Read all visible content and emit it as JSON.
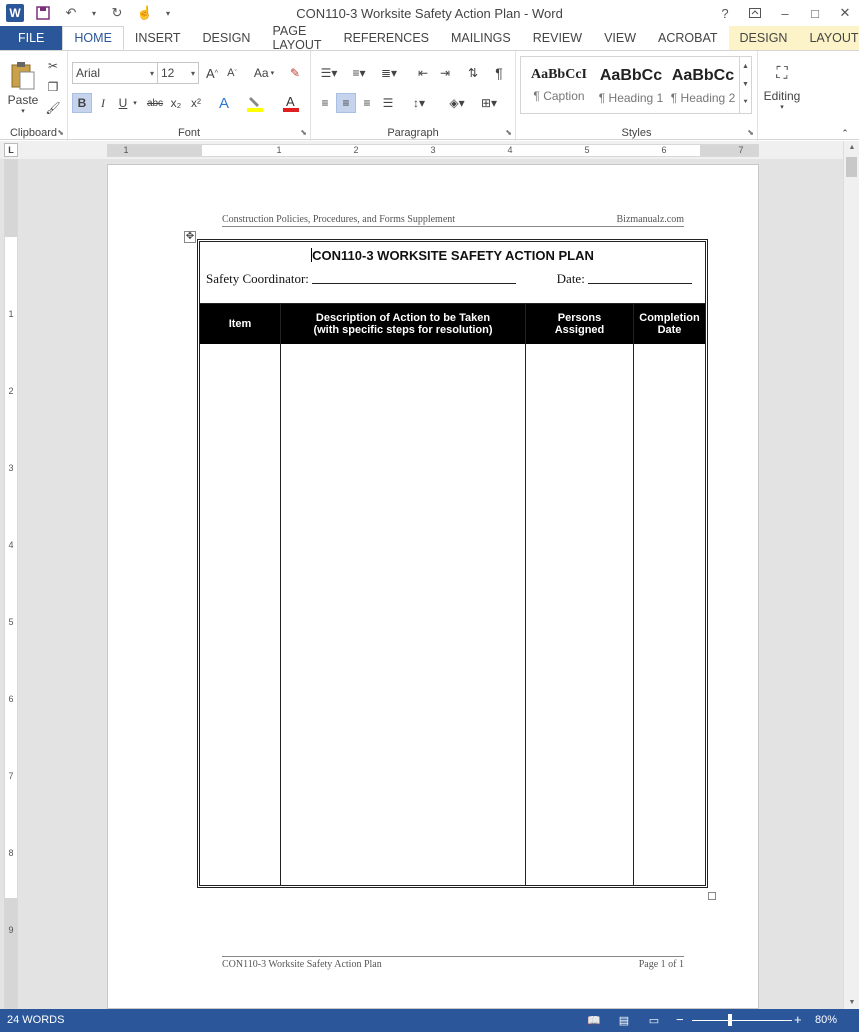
{
  "window": {
    "title": "CON110-3 Worksite Safety Action Plan - Word",
    "help": "?",
    "minimize": "–",
    "maximize": "□",
    "close": "✕"
  },
  "tabs": [
    {
      "label": "FILE"
    },
    {
      "label": "HOME"
    },
    {
      "label": "INSERT"
    },
    {
      "label": "DESIGN"
    },
    {
      "label": "PAGE LAYOUT"
    },
    {
      "label": "REFERENCES"
    },
    {
      "label": "MAILINGS"
    },
    {
      "label": "REVIEW"
    },
    {
      "label": "VIEW"
    },
    {
      "label": "ACROBAT"
    },
    {
      "label": "DESIGN"
    },
    {
      "label": "LAYOUT"
    }
  ],
  "ribbon": {
    "clipboard": {
      "label": "Clipboard",
      "paste": "Paste"
    },
    "font": {
      "label": "Font",
      "name": "Arial",
      "size": "12",
      "case": "Aa",
      "bold": "B",
      "italic": "I",
      "underline": "U",
      "strike": "abc",
      "subscript": "x₂",
      "superscript": "x²",
      "grow": "A",
      "shrink": "A"
    },
    "paragraph": {
      "label": "Paragraph",
      "pilcrow": "¶"
    },
    "styles": {
      "label": "Styles",
      "items": [
        {
          "sample": "AaBbCcI",
          "name": "¶ Caption"
        },
        {
          "sample": "AaBbCc",
          "name": "¶ Heading 1"
        },
        {
          "sample": "AaBbCc",
          "name": "¶ Heading 2"
        }
      ]
    },
    "editing": {
      "label": "Editing"
    }
  },
  "ruler": {
    "corner": "L",
    "h_numbers": [
      "1",
      "1",
      "2",
      "3",
      "4",
      "5",
      "6",
      "7"
    ],
    "v_numbers": [
      "1",
      "2",
      "3",
      "4",
      "5",
      "6",
      "7",
      "8",
      "9"
    ]
  },
  "document": {
    "header_left": "Construction Policies, Procedures, and Forms Supplement",
    "header_right": "Bizmanualz.com",
    "form_title": "CON110-3 WORKSITE SAFETY ACTION PLAN",
    "coordinator_label": "Safety Coordinator:",
    "date_label": "Date:",
    "columns": [
      {
        "header": "Item"
      },
      {
        "header": "Description of Action to be Taken\n(with specific steps for resolution)"
      },
      {
        "header": "Persons\nAssigned"
      },
      {
        "header": "Completion\nDate"
      }
    ],
    "footer_left": "CON110-3 Worksite Safety Action Plan",
    "footer_right": "Page 1 of 1"
  },
  "status": {
    "word_count": "24 WORDS",
    "zoom": "80%",
    "zoom_percent": 80
  },
  "colors": {
    "accent": "#2b579a",
    "context_tab": "#fdf3c8"
  }
}
